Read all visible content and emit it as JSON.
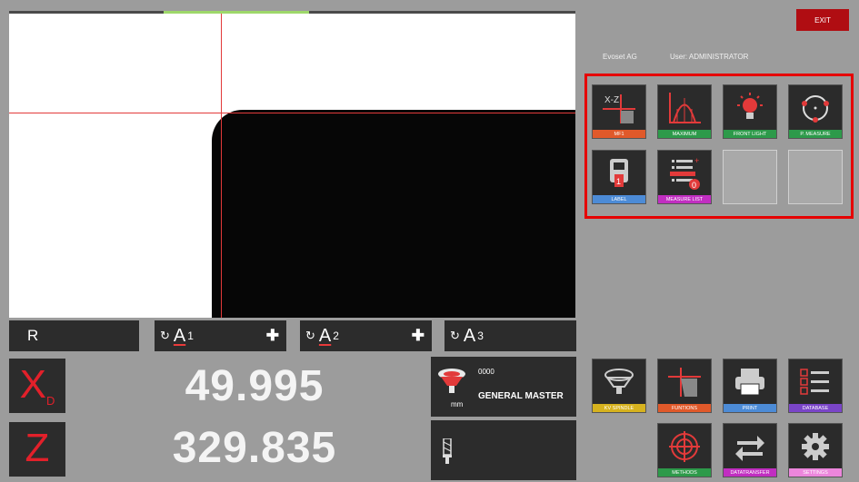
{
  "header": {
    "exit_label": "EXIT",
    "company": "Evoset AG",
    "user": "User: ADMINISTRATOR"
  },
  "menu_tiles": [
    {
      "label": "MF1",
      "icon": "xz-axis-icon",
      "color": "#e0592a"
    },
    {
      "label": "MAXIMUM",
      "icon": "maximum-curve-icon",
      "color": "#2d9a4a"
    },
    {
      "label": "FRONT LIGHT",
      "icon": "bulb-icon",
      "color": "#2d9a4a"
    },
    {
      "label": "P. MEASURE",
      "icon": "circle-points-icon",
      "color": "#2d9a4a"
    },
    {
      "label": "LABEL",
      "icon": "label-printer-icon",
      "color": "#4c8bd6"
    },
    {
      "label": "MEASURE LIST",
      "icon": "measure-list-icon",
      "color": "#c12ec1",
      "badge": "0"
    }
  ],
  "axes": {
    "r_label": "R",
    "a1": "A",
    "a1_sub": "1",
    "a2": "A",
    "a2_sub": "2",
    "a3": "A",
    "a3_sub": "3"
  },
  "readouts": {
    "x_label": "X",
    "x_sub": "D",
    "x_value": "49.995",
    "z_label": "Z",
    "z_value": "329.835"
  },
  "master": {
    "code": "0000",
    "name": "GENERAL MASTER",
    "unit": "mm"
  },
  "tools": [
    {
      "label": "KV SPINDLE",
      "icon": "spindle-icon",
      "color": "#d6b21e"
    },
    {
      "label": "FUNTIONS",
      "icon": "functions-icon",
      "color": "#e0592a"
    },
    {
      "label": "PRINT",
      "icon": "printer-icon",
      "color": "#4c8bd6"
    },
    {
      "label": "DATABASE",
      "icon": "database-icon",
      "color": "#7a45c8"
    },
    {
      "label": "METHODS",
      "icon": "target-icon",
      "color": "#2d9a4a"
    },
    {
      "label": "DATATRANSFER",
      "icon": "transfer-arrows-icon",
      "color": "#c12ec1"
    },
    {
      "label": "SETTINGS",
      "icon": "gear-icon",
      "color": "#ec86dc"
    }
  ]
}
